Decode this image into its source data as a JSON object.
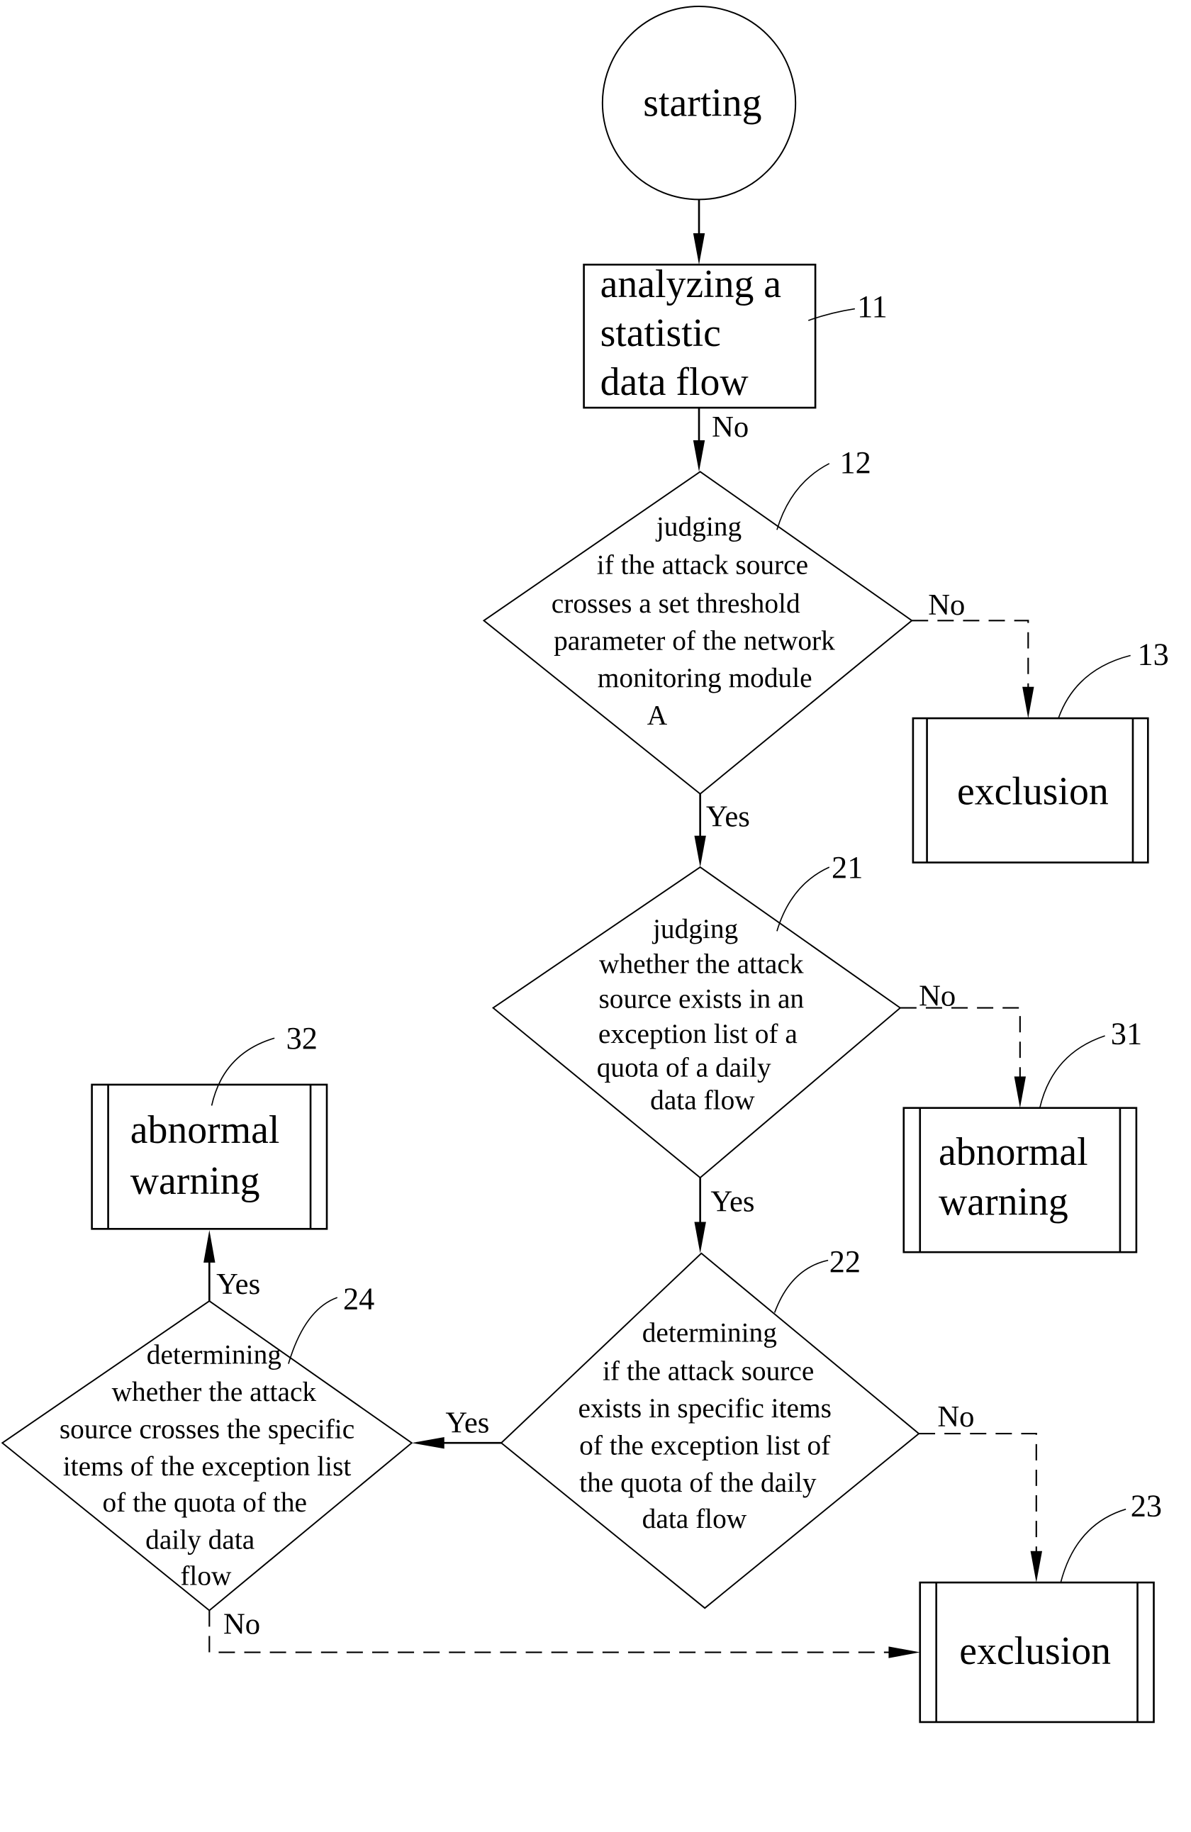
{
  "nodes": {
    "start": {
      "label": "starting"
    },
    "n11": {
      "ref": "11",
      "lines": [
        "analyzing a",
        "statistic",
        "data flow"
      ]
    },
    "n12": {
      "ref": "12",
      "lines": [
        "judging",
        "if the attack source",
        "crosses a set threshold",
        "parameter of the network",
        "monitoring module",
        "A"
      ]
    },
    "n13": {
      "ref": "13",
      "label": "exclusion"
    },
    "n21": {
      "ref": "21",
      "lines": [
        "judging",
        "whether the attack",
        "source exists in an",
        "exception list of a",
        "quota of a daily",
        "data flow"
      ]
    },
    "n31": {
      "ref": "31",
      "lines": [
        "abnormal",
        "warning"
      ]
    },
    "n22": {
      "ref": "22",
      "lines": [
        "determining",
        "if the attack source",
        "exists in specific items",
        "of the exception list of",
        "the quota of the daily",
        "data flow"
      ]
    },
    "n23": {
      "ref": "23",
      "label": "exclusion"
    },
    "n24": {
      "ref": "24",
      "lines": [
        "determining",
        "whether the attack",
        "source crosses the specific",
        "items of the exception list",
        "of the quota of the",
        "daily data",
        "flow"
      ]
    },
    "n32": {
      "ref": "32",
      "lines": [
        "abnormal",
        "warning"
      ]
    }
  },
  "edges": {
    "e11_12": "No",
    "e12_13": "No",
    "e12_21": "Yes",
    "e21_31": "No",
    "e21_22": "Yes",
    "e22_24": "Yes",
    "e22_23": "No",
    "e24_32": "Yes",
    "e24_23": "No"
  }
}
